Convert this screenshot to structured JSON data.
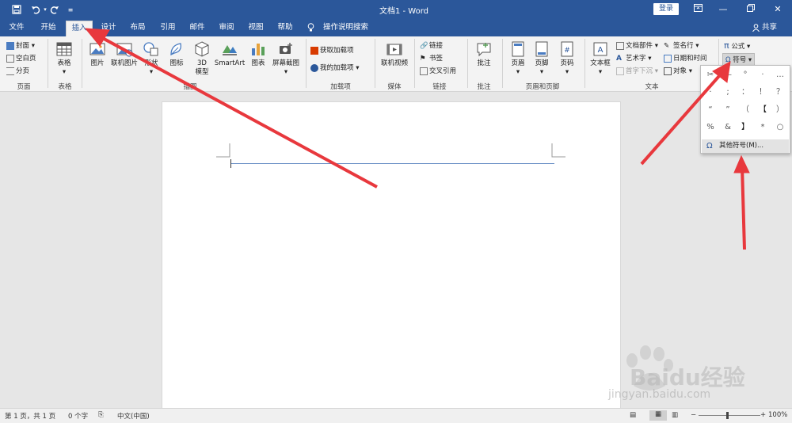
{
  "titlebar": {
    "title": "文档1 - Word",
    "login_label": "登录",
    "quick_access": {
      "save_icon": "save-icon",
      "undo_icon": "undo-icon",
      "redo_icon": "redo-icon",
      "customize_icon": "customize-qat-icon"
    },
    "window_controls": [
      "ribbon-display-icon",
      "minimize-icon",
      "restore-icon",
      "close-icon"
    ]
  },
  "tabs": [
    {
      "label": "文件"
    },
    {
      "label": "开始"
    },
    {
      "label": "插入"
    },
    {
      "label": "设计"
    },
    {
      "label": "布局"
    },
    {
      "label": "引用"
    },
    {
      "label": "邮件"
    },
    {
      "label": "审阅"
    },
    {
      "label": "视图"
    },
    {
      "label": "帮助"
    }
  ],
  "active_tab": "插入",
  "tell_me": "操作说明搜索",
  "share": "共享",
  "ribbon": {
    "pages": {
      "cover": "封面",
      "blank": "空白页",
      "break": "分页",
      "group": "页面"
    },
    "tables": {
      "table": "表格",
      "group": "表格"
    },
    "illustrations": {
      "picture": "图片",
      "online_picture": "联机图片",
      "shapes": "形状",
      "icons": "图标",
      "model3d_a": "3D",
      "model3d_b": "模型",
      "smartart": "SmartArt",
      "chart": "图表",
      "screenshot": "屏幕截图",
      "group": "插图"
    },
    "addins": {
      "get": "获取加载项",
      "mine": "我的加载项",
      "group": "加载项"
    },
    "media": {
      "video": "联机视频",
      "group": "媒体"
    },
    "links": {
      "link": "链接",
      "bookmark": "书签",
      "crossref": "交叉引用",
      "group": "链接"
    },
    "comments": {
      "comment": "批注",
      "group": "批注"
    },
    "header_footer": {
      "header": "页眉",
      "footer": "页脚",
      "page_number": "页码",
      "group": "页眉和页脚"
    },
    "text": {
      "textbox": "文本框",
      "quickparts": "文档部件",
      "wordart": "艺术字",
      "dropcap": "首字下沉",
      "signature": "签名行",
      "datetime": "日期和时间",
      "object": "对象",
      "group": "文本"
    },
    "symbols": {
      "equation": "公式",
      "symbol": "符号"
    }
  },
  "symbol_dropdown": {
    "symbols": [
      "—",
      "°",
      "·",
      "…",
      "·",
      ";",
      "：",
      "！",
      "？",
      "“",
      "”",
      "（",
      "【",
      "）",
      "%",
      "&",
      "】",
      "*",
      "○"
    ],
    "more_label": "其他符号(M)..."
  },
  "status": {
    "page": "第 1 页，共 1 页",
    "words": "0 个字",
    "language": "中文(中国)",
    "zoom": "100%"
  },
  "watermark": {
    "brand": "Baidu经验",
    "url": "jingyan.baidu.com"
  },
  "colors": {
    "title_bar": "#2b579a",
    "ribbon": "#f3f3f3",
    "arrow": "#e8383d"
  }
}
